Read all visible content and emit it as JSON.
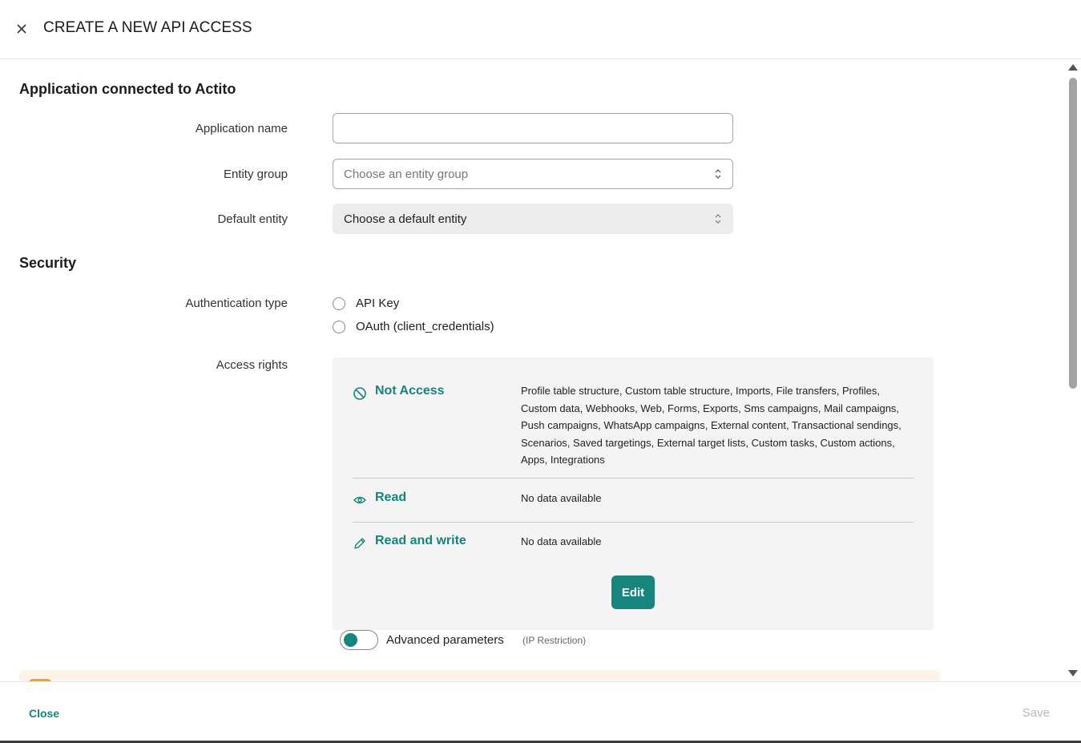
{
  "header": {
    "title": "CREATE A NEW API ACCESS"
  },
  "application": {
    "section_title": "Application connected to Actito",
    "name_label": "Application name",
    "name_value": "",
    "entity_group_label": "Entity group",
    "entity_group_placeholder": "Choose an entity group",
    "default_entity_label": "Default entity",
    "default_entity_value": "Choose a default entity"
  },
  "security": {
    "section_title": "Security",
    "auth_label": "Authentication type",
    "auth_options": [
      "API Key",
      "OAuth (client_credentials)"
    ],
    "access_label": "Access rights",
    "access_rows": [
      {
        "title": "Not Access",
        "icon": "block-icon",
        "text": "Profile table structure, Custom table structure, Imports, File transfers, Profiles, Custom data, Webhooks, Web, Forms, Exports, Sms campaigns, Mail campaigns, Push campaigns, WhatsApp campaigns, External content, Transactional sendings, Scenarios, Saved targetings, External target lists, Custom tasks, Custom actions, Apps, Integrations"
      },
      {
        "title": "Read",
        "icon": "eye-icon",
        "text": "No data available"
      },
      {
        "title": "Read and write",
        "icon": "pencil-icon",
        "text": "No data available"
      }
    ],
    "edit_label": "Edit",
    "advanced_label": "Advanced parameters",
    "advanced_hint": "(IP Restriction)"
  },
  "footer": {
    "close_label": "Close",
    "save_label": "Save"
  },
  "colors": {
    "accent": "#17857e",
    "panel": "#f3f4f3",
    "warning": "#f2a321"
  }
}
